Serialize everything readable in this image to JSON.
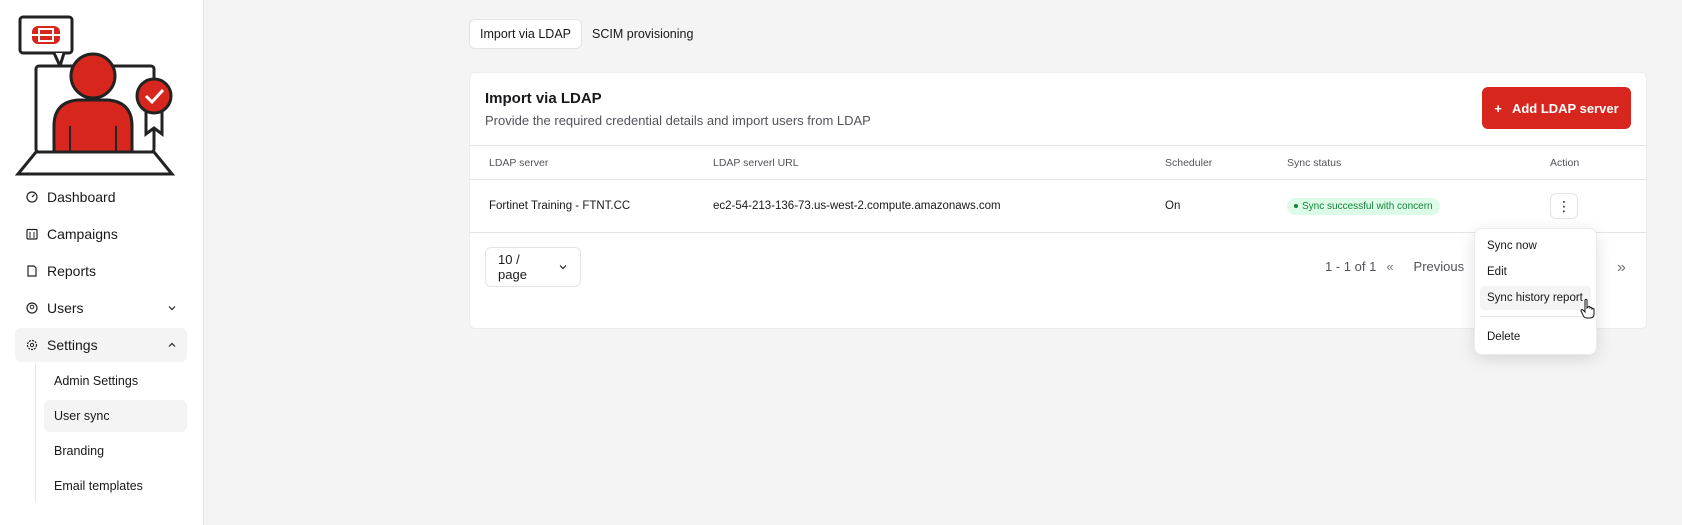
{
  "brand": {
    "logo_name": "Fortinet user certification logo",
    "accent": "#d7261e"
  },
  "sidebar": {
    "items": [
      {
        "label": "Dashboard",
        "icon": "gauge-icon"
      },
      {
        "label": "Campaigns",
        "icon": "calendar-icon"
      },
      {
        "label": "Reports",
        "icon": "document-icon"
      },
      {
        "label": "Users",
        "icon": "user-icon",
        "chevron": "chevron-down-icon"
      },
      {
        "label": "Settings",
        "icon": "gear-icon",
        "chevron": "chevron-up-icon",
        "active": true
      }
    ],
    "settings_sub": [
      {
        "label": "Admin Settings"
      },
      {
        "label": "User sync",
        "active": true
      },
      {
        "label": "Branding"
      },
      {
        "label": "Email templates"
      }
    ]
  },
  "tabs": [
    {
      "label": "Import via LDAP",
      "active": true
    },
    {
      "label": "SCIM provisioning"
    }
  ],
  "card": {
    "title": "Import via LDAP",
    "subtitle": "Provide the required credential details and import users from LDAP",
    "add_button": "Add LDAP server",
    "add_icon": "+"
  },
  "table": {
    "headers": [
      "LDAP server",
      "LDAP serverl URL",
      "Scheduler",
      "Sync status",
      "Action"
    ],
    "rows": [
      {
        "server": "Fortinet Training - FTNT.CC",
        "url": "ec2-54-213-136-73.us-west-2.compute.amazonaws.com",
        "scheduler": "On",
        "status": "Sync successful with concern",
        "action_icon": "⋮"
      }
    ]
  },
  "pagination": {
    "page_size": "10 / page",
    "range": "1 - 1 of 1",
    "first_icon": "«",
    "prev_label": "Previous",
    "last_icon": "»"
  },
  "menu": {
    "items": [
      "Sync now",
      "Edit",
      "Sync history report"
    ],
    "danger_item": "Delete"
  }
}
